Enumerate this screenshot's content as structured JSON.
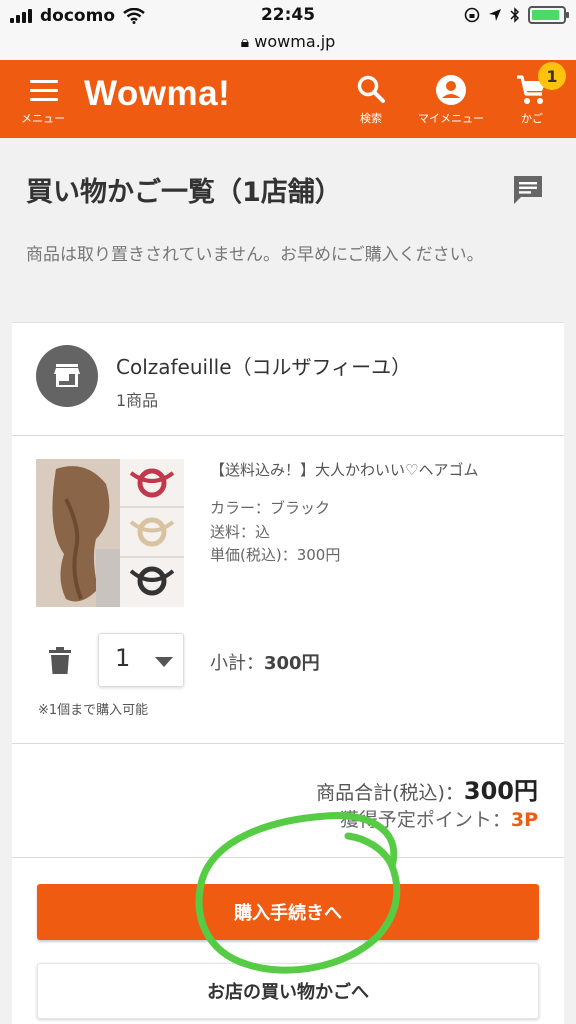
{
  "status_bar": {
    "carrier": "docomo",
    "time": "22:45",
    "url": "wowma.jp",
    "battery_level": 0.9
  },
  "header": {
    "logo": "Wowma!",
    "menu_label": "メニュー",
    "search_label": "検索",
    "mymenu_label": "マイメニュー",
    "cart_label": "かご",
    "cart_badge": "1",
    "accent_color": "#f05b12"
  },
  "page": {
    "title": "買い物かご一覧（1店舗）",
    "notice": "商品は取り置きされていません。お早めにご購入ください。"
  },
  "shop": {
    "name": "Colzafeuille（コルザフィーユ）",
    "item_count": "1商品"
  },
  "product": {
    "title": "【送料込み！】大人かわいい♡ヘアゴム",
    "color": "カラー：ブラック",
    "shipping": "送料：込",
    "unit_price": "単価(税込)：300円",
    "quantity": "1",
    "subtotal_label": "小計：",
    "subtotal_value": "300円",
    "limit_note": "※1個まで購入可能"
  },
  "summary": {
    "total_label": "商品合計(税込)：",
    "total_value": "300円",
    "points_label": "獲得予定ポイント：",
    "points_value": "3P"
  },
  "buttons": {
    "checkout": "購入手続きへ",
    "shop_cart": "お店の買い物かごへ"
  },
  "icons": [
    "hamburger-icon",
    "search-icon",
    "account-icon",
    "cart-icon",
    "chat-icon",
    "store-icon",
    "trash-icon",
    "chevron-down-icon",
    "lock-icon",
    "wifi-icon",
    "location-icon",
    "bluetooth-icon"
  ]
}
